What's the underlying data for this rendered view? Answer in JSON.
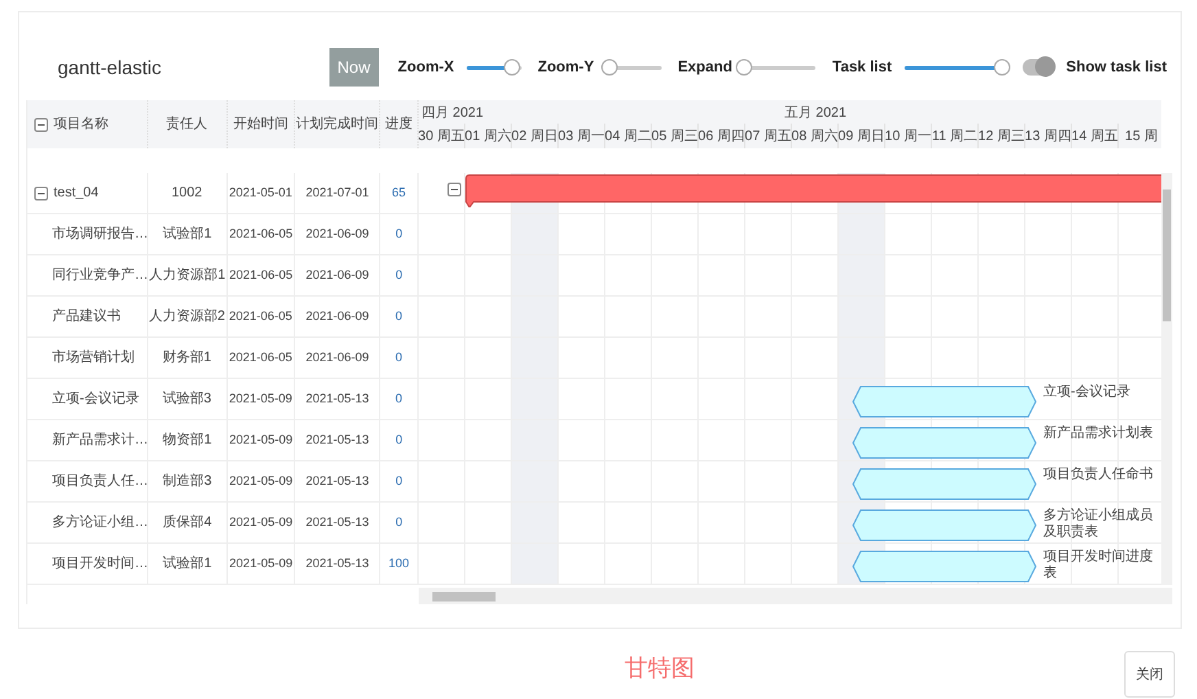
{
  "title": "gantt-elastic",
  "toolbar": {
    "now_button": "Now",
    "sliders": [
      {
        "label": "Zoom-X",
        "level": 0.82
      },
      {
        "label": "Zoom-Y",
        "level": 0.06
      },
      {
        "label": "Expand",
        "level": 0
      },
      {
        "label": "Task list",
        "level": 0.96
      }
    ],
    "show_task_list": {
      "label": "Show task list",
      "on": true
    }
  },
  "columns": [
    "项目名称",
    "责任人",
    "开始时间",
    "计划完成时间",
    "进度"
  ],
  "timeline": {
    "months": [
      {
        "label": "四月 2021",
        "days": [
          {
            "label": "30 周五",
            "shaded": false
          }
        ]
      },
      {
        "label": "五月 2021",
        "days": [
          {
            "label": "01 周六",
            "shaded": false
          },
          {
            "label": "02 周日",
            "shaded": true
          },
          {
            "label": "03 周一",
            "shaded": false
          },
          {
            "label": "04 周二",
            "shaded": false
          },
          {
            "label": "05 周三",
            "shaded": false
          },
          {
            "label": "06 周四",
            "shaded": false
          },
          {
            "label": "07 周五",
            "shaded": false
          },
          {
            "label": "08 周六",
            "shaded": false
          },
          {
            "label": "09 周日",
            "shaded": true
          },
          {
            "label": "10 周一",
            "shaded": false
          },
          {
            "label": "11 周二",
            "shaded": false
          },
          {
            "label": "12 周三",
            "shaded": false
          },
          {
            "label": "13 周四",
            "shaded": false
          },
          {
            "label": "14 周五",
            "shaded": false
          },
          {
            "label": "15 周",
            "shaded": false
          }
        ]
      }
    ]
  },
  "tasks": [
    {
      "name": "test_04",
      "owner": "1002",
      "start": "2021-05-01",
      "end": "2021-07-01",
      "progress": "65",
      "expanded": true,
      "children": [
        {
          "name": "市场调研报告…",
          "owner": "试验部1",
          "start": "2021-06-05",
          "end": "2021-06-09",
          "progress": "0"
        },
        {
          "name": "同行业竞争产…",
          "owner": "人力资源部1",
          "start": "2021-06-05",
          "end": "2021-06-09",
          "progress": "0"
        },
        {
          "name": "产品建议书",
          "owner": "人力资源部2",
          "start": "2021-06-05",
          "end": "2021-06-09",
          "progress": "0"
        },
        {
          "name": "市场营销计划",
          "owner": "财务部1",
          "start": "2021-06-05",
          "end": "2021-06-09",
          "progress": "0"
        },
        {
          "name": "立项-会议记录",
          "owner": "试验部3",
          "start": "2021-05-09",
          "end": "2021-05-13",
          "progress": "0",
          "bar_label": "立项-会议记录"
        },
        {
          "name": "新产品需求计…",
          "owner": "物资部1",
          "start": "2021-05-09",
          "end": "2021-05-13",
          "progress": "0",
          "bar_label": "新产品需求计划表"
        },
        {
          "name": "项目负责人任…",
          "owner": "制造部3",
          "start": "2021-05-09",
          "end": "2021-05-13",
          "progress": "0",
          "bar_label": "项目负责人任命书"
        },
        {
          "name": "多方论证小组…",
          "owner": "质保部4",
          "start": "2021-05-09",
          "end": "2021-05-13",
          "progress": "0",
          "bar_label": "多方论证小组成员及职责表"
        },
        {
          "name": "项目开发时间…",
          "owner": "试验部1",
          "start": "2021-05-09",
          "end": "2021-05-13",
          "progress": "100",
          "bar_label": "项目开发时间进度表"
        }
      ]
    }
  ],
  "footer": {
    "caption": "甘特图",
    "close_button": "关闭"
  }
}
